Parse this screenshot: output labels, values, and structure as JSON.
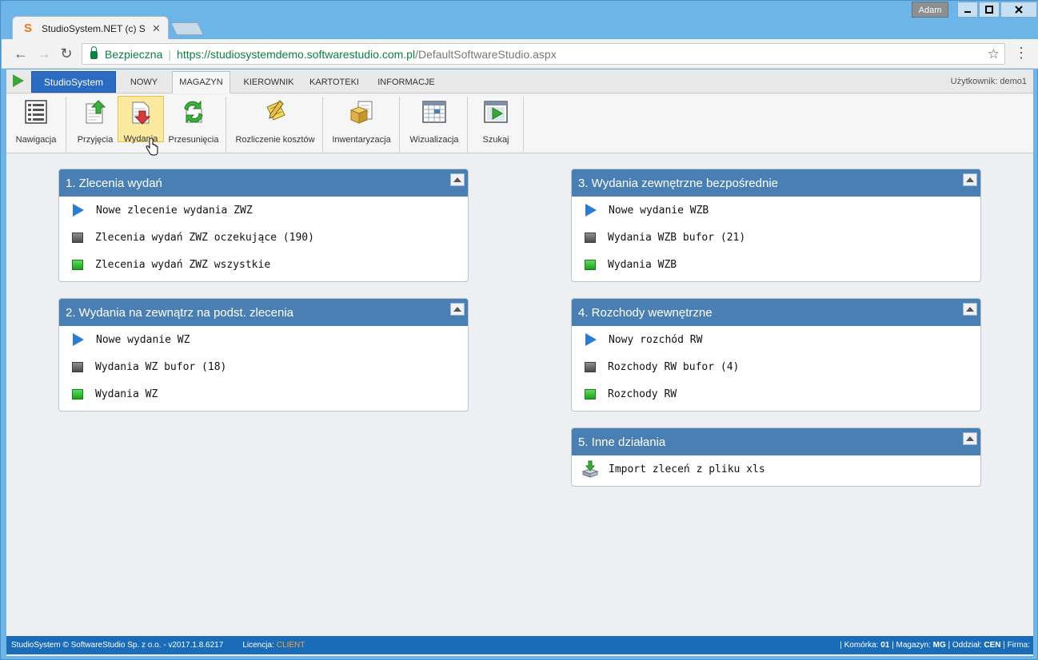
{
  "window": {
    "user_chip": "Adam",
    "tab_title": "StudioSystem.NET (c) Sof",
    "tab_logo": "S"
  },
  "address_bar": {
    "secure_label": "Bezpieczna",
    "url_scheme_host": "https://studiosystemdemo.softwarestudio.com.pl",
    "url_path": "/DefaultSoftwareStudio.aspx"
  },
  "menubar": {
    "brand": "StudioSystem",
    "tabs": [
      {
        "label": "NOWY"
      },
      {
        "label": "MAGAZYN",
        "active": true
      },
      {
        "label": "KIEROWNIK"
      },
      {
        "label": "KARTOTEKI"
      },
      {
        "label": "INFORMACJE"
      }
    ],
    "user": "Użytkownik: demo1"
  },
  "ribbon": {
    "items": [
      {
        "label": "Nawigacja",
        "icon": "navigation-icon"
      },
      {
        "label": "Przyjęcia",
        "icon": "receipt-icon"
      },
      {
        "label": "Wydania",
        "icon": "issue-icon",
        "selected": true
      },
      {
        "label": "Przesunięcia",
        "icon": "transfer-icon"
      },
      {
        "label": "Rozliczenie kosztów",
        "icon": "cost-settlement-icon"
      },
      {
        "label": "Inwentaryzacja",
        "icon": "inventory-icon"
      },
      {
        "label": "Wizualizacja",
        "icon": "visualization-icon"
      },
      {
        "label": "Szukaj",
        "icon": "search-play-icon"
      }
    ]
  },
  "panels": [
    {
      "title": "1. Zlecenia wydań",
      "rows": [
        {
          "icon": "play-arrow-icon",
          "label": "Nowe zlecenie wydania ZWZ"
        },
        {
          "icon": "gray-square-icon",
          "label": "Zlecenia wydań ZWZ oczekujące (190)"
        },
        {
          "icon": "green-square-icon",
          "label": "Zlecenia wydań ZWZ wszystkie"
        }
      ]
    },
    {
      "title": "2. Wydania na zewnątrz na podst. zlecenia",
      "rows": [
        {
          "icon": "play-arrow-icon",
          "label": "Nowe wydanie WZ"
        },
        {
          "icon": "gray-square-icon",
          "label": "Wydania WZ bufor (18)"
        },
        {
          "icon": "green-square-icon",
          "label": "Wydania WZ"
        }
      ]
    },
    {
      "title": "3. Wydania zewnętrzne bezpośrednie",
      "rows": [
        {
          "icon": "play-arrow-icon",
          "label": "Nowe wydanie WZB"
        },
        {
          "icon": "gray-square-icon",
          "label": "Wydania WZB bufor (21)"
        },
        {
          "icon": "green-square-icon",
          "label": "Wydania WZB"
        }
      ]
    },
    {
      "title": "4. Rozchody wewnętrzne",
      "rows": [
        {
          "icon": "play-arrow-icon",
          "label": "Nowy rozchód RW"
        },
        {
          "icon": "gray-square-icon",
          "label": "Rozchody RW bufor (4)"
        },
        {
          "icon": "green-square-icon",
          "label": "Rozchody RW"
        }
      ]
    },
    {
      "title": "5. Inne działania",
      "rows": [
        {
          "icon": "import-icon",
          "label": "Import zleceń z pliku xls"
        }
      ]
    }
  ],
  "statusbar": {
    "copyright": "StudioSystem © SoftwareStudio Sp. z o.o. - v2017.1.8.6217",
    "license_label": "Licencja:",
    "license_value": "CLIENT",
    "cell_label": "Komórka:",
    "cell_value": "01",
    "warehouse_label": "Magazyn:",
    "warehouse_value": "MG",
    "branch_label": "Oddział:",
    "branch_value": "CEN",
    "company_label": "Firma:"
  },
  "colors": {
    "panel_header": "#4a7fb4",
    "brand_button": "#2b6bc2",
    "status_bar": "#1a6cb9",
    "selected_ribbon": "#fbe9a0"
  }
}
